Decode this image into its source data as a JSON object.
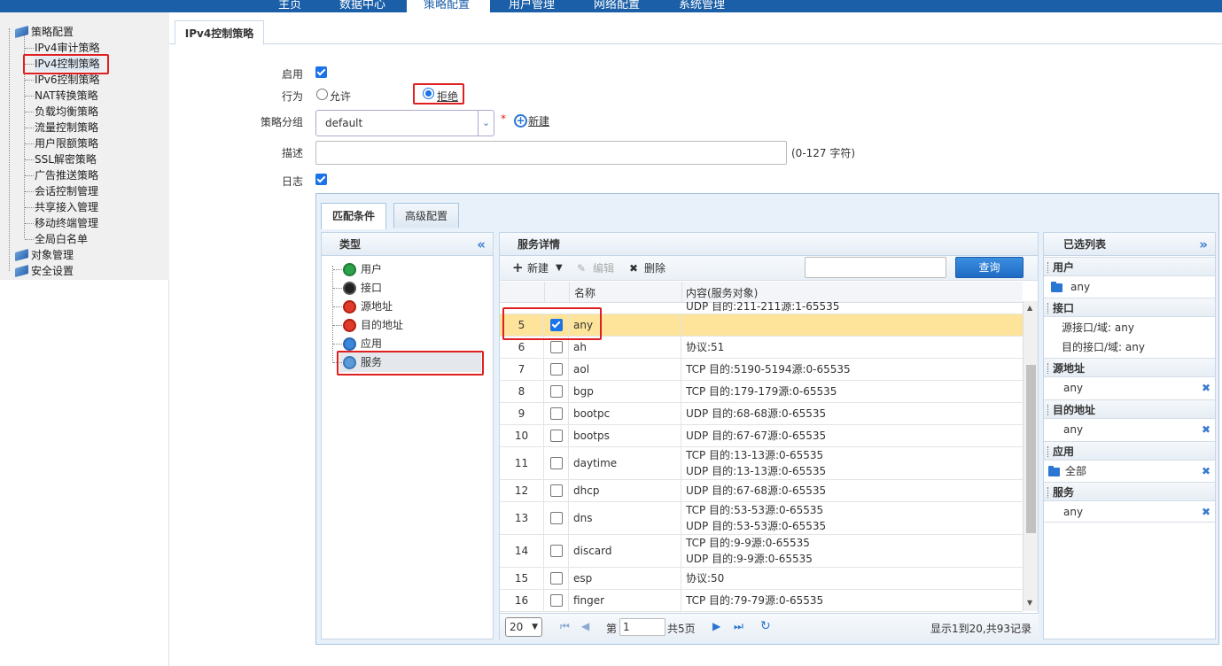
{
  "topnav": {
    "items": [
      "主页",
      "数据中心",
      "策略配置",
      "用户管理",
      "网络配置",
      "系统管理"
    ]
  },
  "sidebar": {
    "root": "策略配置",
    "items": [
      "IPv4审计策略",
      "IPv4控制策略",
      "IPv6控制策略",
      "NAT转换策略",
      "负载均衡策略",
      "流量控制策略",
      "用户限额策略",
      "SSL解密策略",
      "广告推送策略",
      "会话控制管理",
      "共享接入管理",
      "移动终端管理",
      "全局白名单"
    ],
    "roots2": [
      "对象管理",
      "安全设置"
    ]
  },
  "page_tab": "IPv4控制策略",
  "form": {
    "enable_label": "启用",
    "action_label": "行为",
    "allow_label": "允许",
    "deny_label": "拒绝",
    "group_label": "策略分组",
    "group_value": "default",
    "required_mark": "*",
    "new_link": "新建",
    "desc_label": "描述",
    "desc_hint": "(0-127 字符)",
    "log_label": "日志"
  },
  "panel": {
    "tab1": "匹配条件",
    "tab2": "高级配置",
    "type_head": "类型",
    "collapse_left": "«",
    "types": [
      "用户",
      "接口",
      "源地址",
      "目的地址",
      "应用",
      "服务"
    ],
    "detail_head": "服务详情",
    "toolbar": {
      "new": "新建",
      "edit": "编辑",
      "delete": "删除",
      "query": "查询"
    },
    "columns": {
      "name": "名称",
      "content": "内容(服务对象)"
    },
    "partial_row": "UDP 目的:211-211源:1-65535",
    "rows": [
      {
        "num": "5",
        "name": "any",
        "content": [
          "",
          ""
        ],
        "checked": true
      },
      {
        "num": "6",
        "name": "ah",
        "content": [
          "协议:51"
        ]
      },
      {
        "num": "7",
        "name": "aol",
        "content": [
          "TCP 目的:5190-5194源:0-65535"
        ]
      },
      {
        "num": "8",
        "name": "bgp",
        "content": [
          "TCP 目的:179-179源:0-65535"
        ]
      },
      {
        "num": "9",
        "name": "bootpc",
        "content": [
          "UDP 目的:68-68源:0-65535"
        ]
      },
      {
        "num": "10",
        "name": "bootps",
        "content": [
          "UDP 目的:67-67源:0-65535"
        ]
      },
      {
        "num": "11",
        "name": "daytime",
        "content": [
          "TCP 目的:13-13源:0-65535",
          "UDP 目的:13-13源:0-65535"
        ]
      },
      {
        "num": "12",
        "name": "dhcp",
        "content": [
          "UDP 目的:67-68源:0-65535"
        ]
      },
      {
        "num": "13",
        "name": "dns",
        "content": [
          "TCP 目的:53-53源:0-65535",
          "UDP 目的:53-53源:0-65535"
        ]
      },
      {
        "num": "14",
        "name": "discard",
        "content": [
          "TCP 目的:9-9源:0-65535",
          "UDP 目的:9-9源:0-65535"
        ]
      },
      {
        "num": "15",
        "name": "esp",
        "content": [
          "协议:50"
        ]
      },
      {
        "num": "16",
        "name": "finger",
        "content": [
          "TCP 目的:79-79源:0-65535"
        ]
      }
    ],
    "pager": {
      "size": "20",
      "page_prefix": "第",
      "page": "1",
      "page_suffix": "共5页",
      "summary": "显示1到20,共93记录"
    },
    "selected_head": "已选列表",
    "collapse_right": "»",
    "selected": {
      "user_head": "用户",
      "user_val": "any",
      "iface_head": "接口",
      "iface_src": "源接口/域: any",
      "iface_dst": "目的接口/域: any",
      "src_head": "源地址",
      "src_val": "any",
      "dst_head": "目的地址",
      "dst_val": "any",
      "app_head": "应用",
      "app_val": "全部",
      "svc_head": "服务",
      "svc_val": "any"
    }
  },
  "colors": {
    "accent": "#1a73e8",
    "highlight_row": "#fde49a",
    "red_box": "#e02020",
    "nav": "#1b5fa8"
  }
}
